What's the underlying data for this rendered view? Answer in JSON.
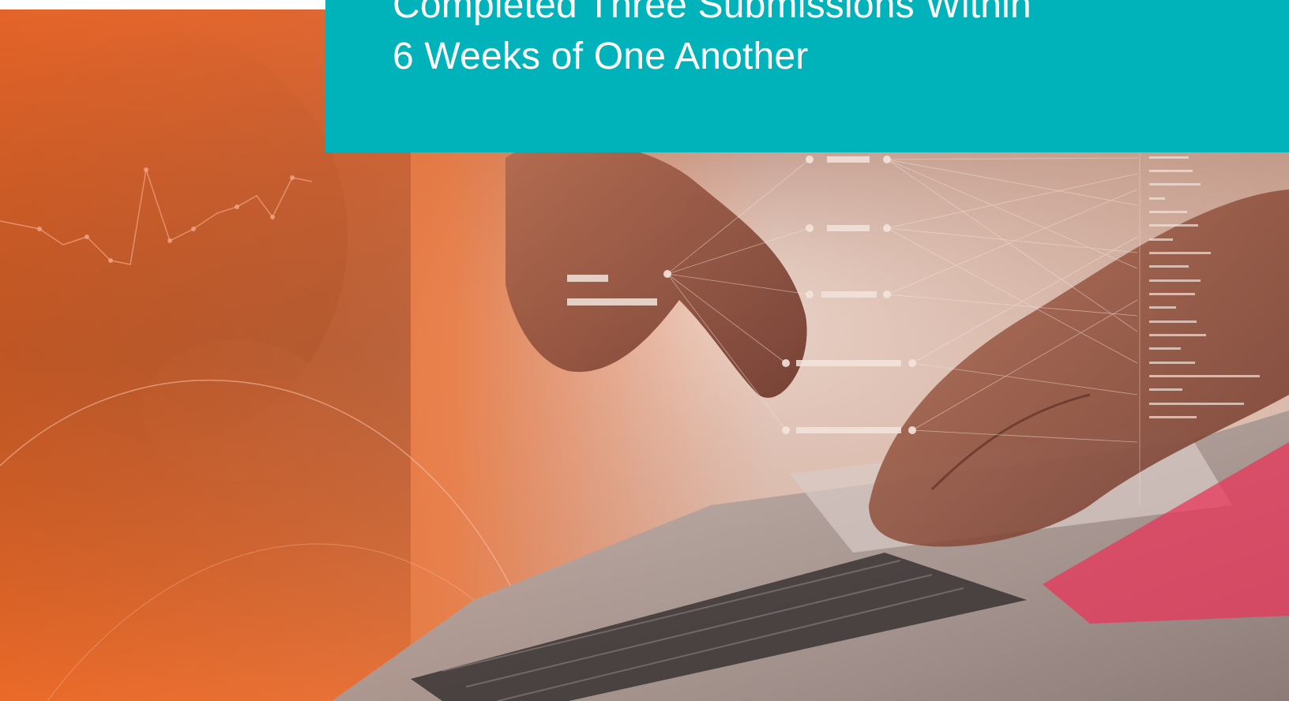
{
  "headline": {
    "line1": "Completed Three Submissions Within",
    "line2": "6 Weeks of One Another"
  },
  "colors": {
    "banner": "#00b3bb",
    "orange": "#e86a2c",
    "pink": "#e8355a"
  },
  "image": {
    "subject": "hands-typing-on-laptop-with-network-overlay"
  }
}
